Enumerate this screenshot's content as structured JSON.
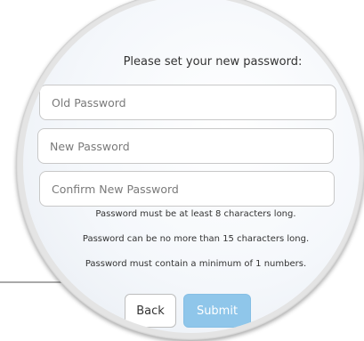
{
  "form": {
    "title": "Please set your new password:",
    "old_password_placeholder": "Old Password",
    "new_password_placeholder": "New Password",
    "confirm_password_placeholder": "Confirm New Password",
    "rules": [
      "Password must be at least 8 characters long.",
      "Password can be no more than 15 characters long.",
      "Password must contain a minimum of 1 numbers."
    ],
    "back_label": "Back",
    "submit_label": "Submit"
  },
  "colors": {
    "submit_button": "#8fc6ea",
    "magnifier_rim": "#e4e4e4",
    "connector_line": "#a9a9a9"
  }
}
